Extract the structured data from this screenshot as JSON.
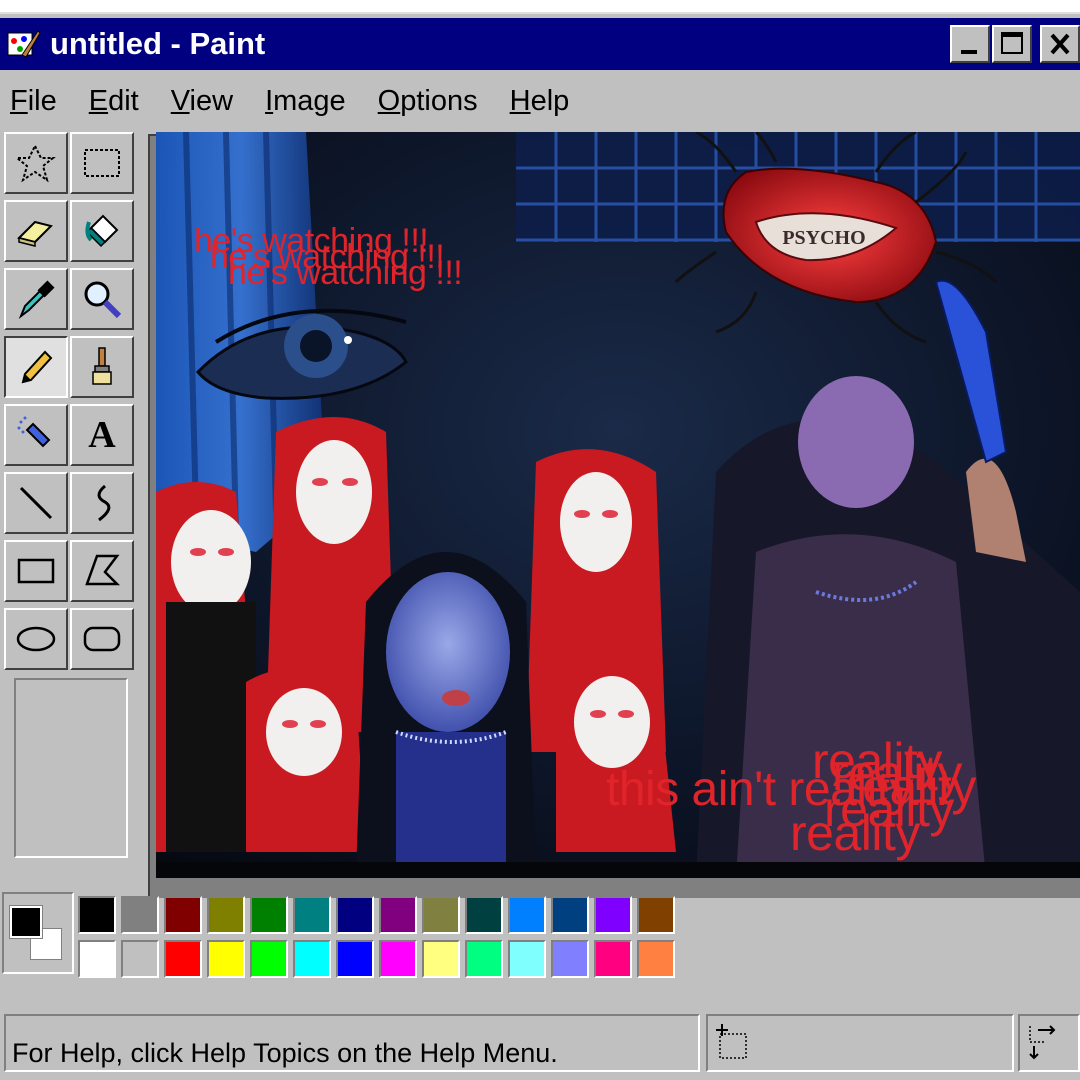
{
  "window": {
    "title": "untitled - Paint",
    "buttons": {
      "minimize": "minimize",
      "maximize": "maximize",
      "close": "close"
    }
  },
  "menu": [
    {
      "first": "F",
      "rest": "ile"
    },
    {
      "first": "E",
      "rest": "dit"
    },
    {
      "first": "V",
      "rest": "iew"
    },
    {
      "first": "I",
      "rest": "mage"
    },
    {
      "first": "O",
      "rest": "ptions"
    },
    {
      "first": "H",
      "rest": "elp"
    }
  ],
  "tools": [
    "free-form-select-icon",
    "select-icon",
    "eraser-icon",
    "fill-with-color-icon",
    "pick-color-icon",
    "magnifier-icon",
    "pencil-icon",
    "brush-icon",
    "airbrush-icon",
    "text-icon",
    "line-icon",
    "curve-icon",
    "rectangle-icon",
    "polygon-icon",
    "ellipse-icon",
    "rounded-rectangle-icon"
  ],
  "active_tool": "pencil-icon",
  "text_tool_glyph": "A",
  "canvas": {
    "texts": {
      "watch1": "he's watching !!!",
      "watch2": "he's watching !!!",
      "watch3": "he's watching !!!",
      "ain_t": "this ain't reality...",
      "reality1": "reality",
      "reality2": "reality",
      "reality3": "reality",
      "reality4": "reality",
      "reality5": "reality"
    },
    "lips_text": "PSYCHO",
    "text_color": "#e0242b"
  },
  "palette": {
    "foreground": "#000000",
    "background": "#ffffff",
    "top_row": [
      "#000000",
      "#808080",
      "#800000",
      "#808000",
      "#008000",
      "#008080",
      "#000080",
      "#800080",
      "#808040",
      "#004040",
      "#0080ff",
      "#004080",
      "#8000ff",
      "#804000"
    ],
    "bottom_row": [
      "#ffffff",
      "#c0c0c0",
      "#ff0000",
      "#ffff00",
      "#00ff00",
      "#00ffff",
      "#0000ff",
      "#ff00ff",
      "#ffff80",
      "#00ff80",
      "#80ffff",
      "#8080ff",
      "#ff0080",
      "#ff8040"
    ]
  },
  "status": {
    "help": "For Help, click Help Topics on the Help Menu."
  }
}
